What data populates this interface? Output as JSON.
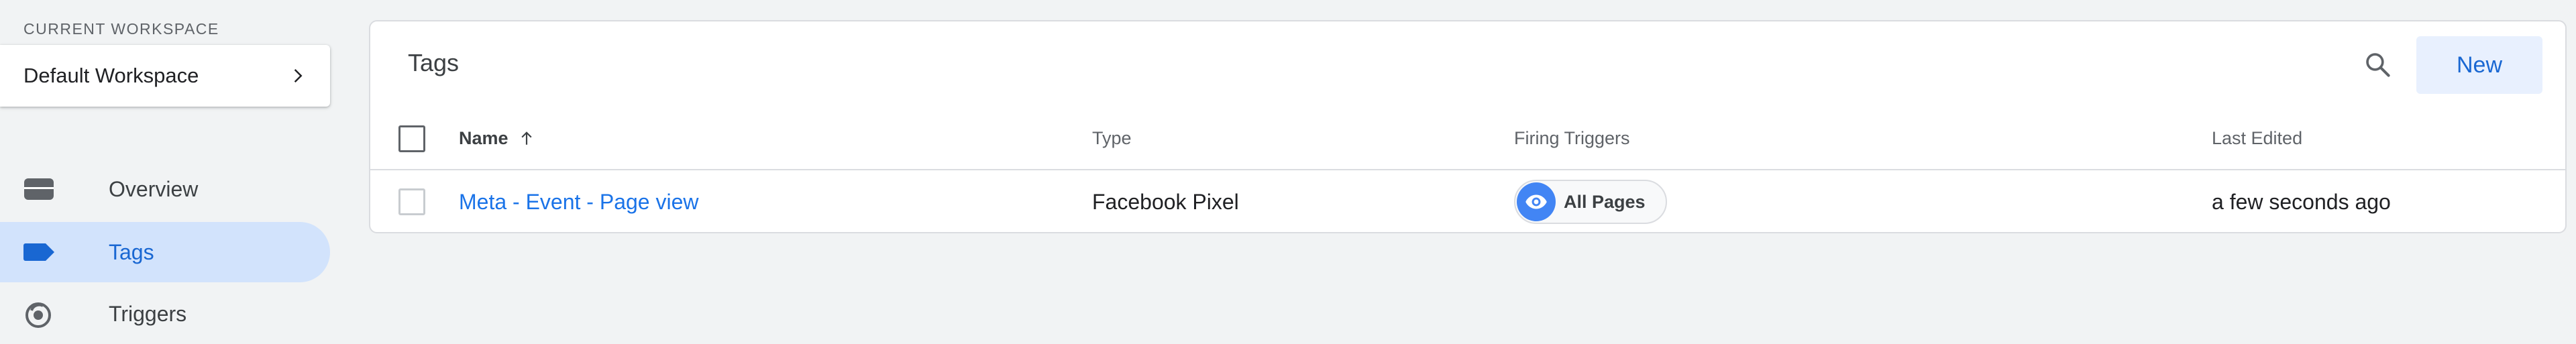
{
  "sidebar": {
    "workspace_label": "CURRENT WORKSPACE",
    "workspace_name": "Default Workspace",
    "items": [
      {
        "label": "Overview",
        "icon": "overview-icon"
      },
      {
        "label": "Tags",
        "icon": "tag-icon",
        "active": true
      },
      {
        "label": "Triggers",
        "icon": "triggers-icon"
      }
    ]
  },
  "main": {
    "title": "Tags",
    "new_label": "New",
    "columns": [
      "Name",
      "Type",
      "Firing Triggers",
      "Last Edited"
    ],
    "sort": {
      "column": "Name",
      "direction": "ascending"
    },
    "rows": [
      {
        "name": "Meta - Event - Page view",
        "type": "Facebook Pixel",
        "trigger": "All Pages",
        "last_edited": "a few seconds ago"
      }
    ]
  },
  "colors": {
    "accent": "#1967d2",
    "link": "#1a73e8",
    "active_nav_bg": "#d2e3fc",
    "trigger_icon_bg": "#4285f4"
  }
}
